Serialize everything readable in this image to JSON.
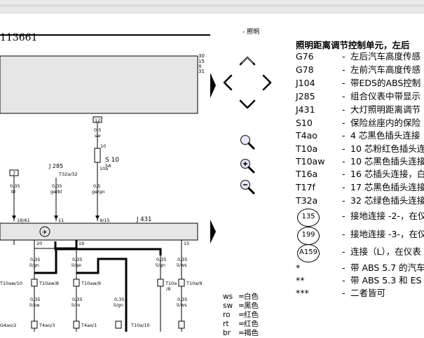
{
  "diagram": {
    "page_code": "113661",
    "bus_labels": [
      "30",
      "15",
      "X",
      "31"
    ],
    "fuse_top": "12",
    "fuse_wire": {
      "size": "0,5",
      "color": "sw"
    },
    "fuse_id": "S 10",
    "fuse_amp": "5A",
    "fuse_term_top": "10",
    "fuse_term_bottom": "10a",
    "j285": {
      "label": "J 285",
      "pin": "T32a/32"
    },
    "j431": "J 431",
    "relay_small": "7",
    "wires_top": [
      {
        "size": "0,35",
        "color": "bl"
      },
      {
        "size": "0,35",
        "color": "ge/bl"
      },
      {
        "size": "0,5",
        "color": "ge/gn"
      }
    ],
    "pins_top": [
      "18/61",
      "11",
      "9/15"
    ],
    "pins_bottom": [
      "20",
      "19",
      "15"
    ],
    "wires_mid": [
      {
        "size": "0,35",
        "color": "li/gn"
      },
      {
        "size": "0,35",
        "color": "li/ge"
      },
      {
        "size": "0,35",
        "color": "li/gn"
      },
      {
        "size": "0,35",
        "color": "li/ws"
      }
    ],
    "connectors_mid": [
      "T10aw/10",
      "T10aw/8",
      "T10aw/9",
      "T10a",
      "/8",
      "T10a/9"
    ],
    "wires_low": [
      {
        "size": "0,35",
        "color": "li/sw"
      },
      {
        "size": "0,35",
        "color": "li/ro"
      },
      {
        "size": "0,35",
        "color": "li/gn"
      },
      {
        "size": "0,35",
        "color": "li/ws"
      }
    ],
    "connectors_low": [
      "G4ao/2",
      "T4ao/3",
      "T4ao/1",
      "T10a/10"
    ]
  },
  "nav": {
    "up_icon": "arrow-up-icon",
    "left_icon": "arrow-left-icon",
    "right_icon": "arrow-right-icon",
    "down_icon": "arrow-down-icon",
    "search_icon": "magnifier-icon",
    "zoom_in_icon": "zoom-in-icon",
    "zoom_out_icon": "zoom-out-icon",
    "page_prev_icon": "triangle-right-icon",
    "page_next_icon": "triangle-right-icon"
  },
  "header_fragment": "- 照明",
  "legend": {
    "title": "照明距离调节控制单元，左后",
    "items": [
      {
        "code": "G76",
        "desc": "左后汽车高度传感"
      },
      {
        "code": "G78",
        "desc": "左前汽车高度传感"
      },
      {
        "code": "J104",
        "desc": "带EDS的ABS控制"
      },
      {
        "code": "J285",
        "desc": "组合仪表中带显示"
      },
      {
        "code": "J431",
        "desc": "大灯照明距离调节"
      },
      {
        "code": "S10",
        "desc": "保险丝座内的保险"
      },
      {
        "code": "T4ao",
        "desc": "4 芯黑色插头连接"
      },
      {
        "code": "T10a",
        "desc": "10 芯粉红色插头连"
      },
      {
        "code": "T10aw",
        "desc": "10 芯黑色插头连接"
      },
      {
        "code": "T16a",
        "desc": "16 芯插头连接，白"
      },
      {
        "code": "T17f",
        "desc": "17 芯黑色插头连接"
      },
      {
        "code": "T32a",
        "desc": "32 芯绿色插头连接"
      }
    ],
    "grounds": [
      {
        "num": "135",
        "desc": "接地连接 -2-，在仪"
      },
      {
        "num": "199",
        "desc": "接地连接 -3-，在仪"
      },
      {
        "num": "A159",
        "desc": "连接（L），在仪表"
      }
    ],
    "notes": [
      {
        "mark": "*",
        "desc": "带 ABS 5.7 的汽车"
      },
      {
        "mark": "**",
        "desc": "带 ABS 5.3 和 ES"
      },
      {
        "mark": "***",
        "desc": "二者皆可"
      }
    ]
  },
  "colors": [
    {
      "code": "ws",
      "name": "白色"
    },
    {
      "code": "sw",
      "name": "黑色"
    },
    {
      "code": "ro",
      "name": "红色"
    },
    {
      "code": "rt",
      "name": "红色"
    },
    {
      "code": "br",
      "name": "褐色"
    }
  ]
}
